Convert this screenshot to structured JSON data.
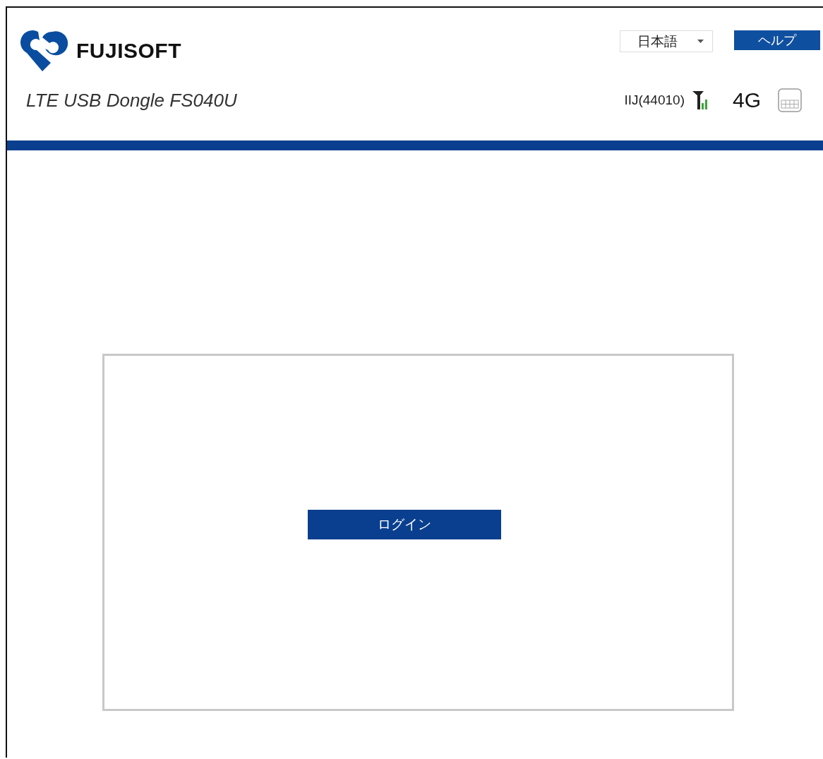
{
  "header": {
    "brand": "FUJISOFT",
    "language": "日本語",
    "help": "ヘルプ",
    "product": "LTE USB Dongle FS040U",
    "carrier": "IIJ(44010)",
    "network": "4G"
  },
  "login": {
    "button": "ログイン"
  }
}
